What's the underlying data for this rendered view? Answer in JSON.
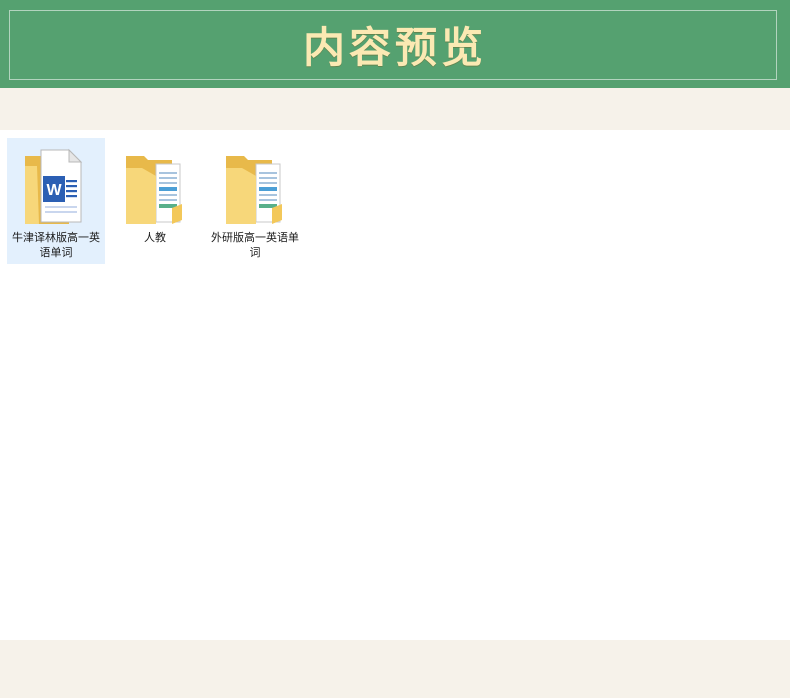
{
  "header": {
    "title": "内容预览"
  },
  "files": [
    {
      "label": "牛津译林版高一英语单词",
      "type": "word-document",
      "selected": true
    },
    {
      "label": "人教",
      "type": "folder",
      "selected": false
    },
    {
      "label": "外研版高一英语单词",
      "type": "folder",
      "selected": false
    }
  ],
  "colors": {
    "header_bg": "#55a170",
    "title": "#fbe9b3",
    "selection": "#e3f0fd",
    "page_bg": "#f6f2ea",
    "folder": "#f7d77a"
  }
}
